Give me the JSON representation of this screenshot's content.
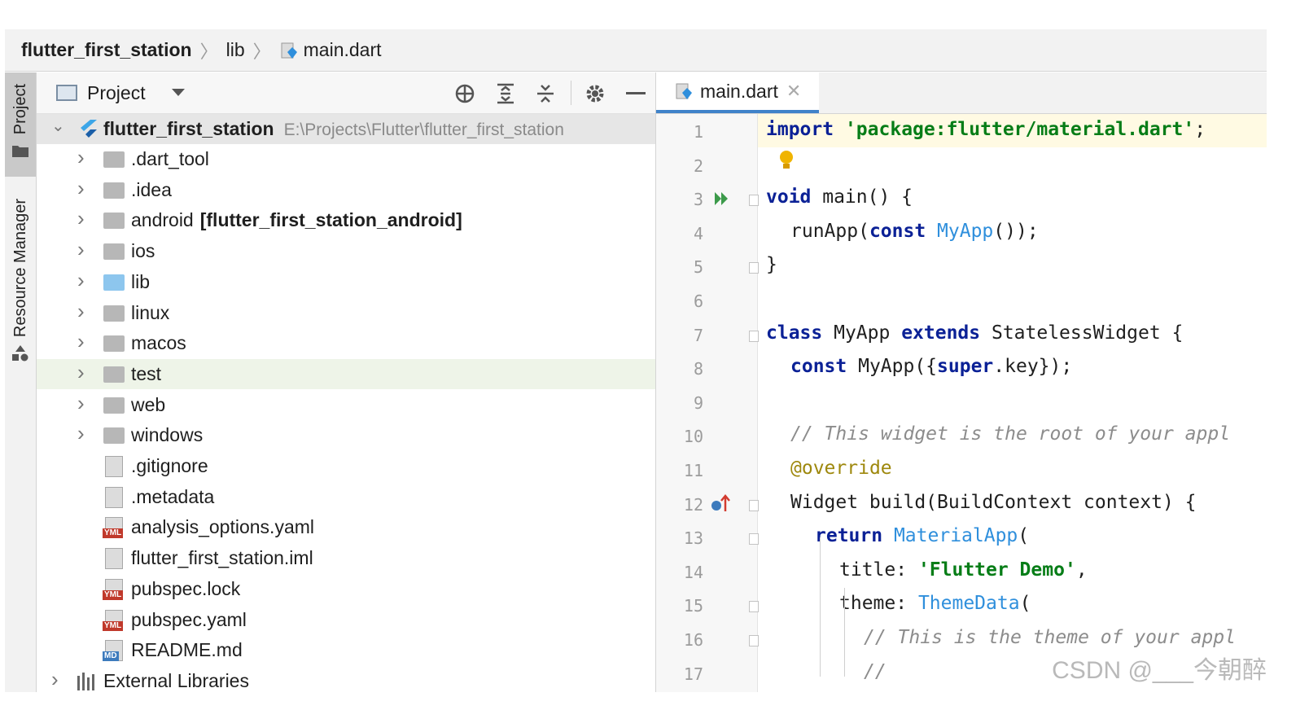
{
  "breadcrumb": {
    "root": "flutter_first_station",
    "folder": "lib",
    "file": "main.dart"
  },
  "toolstrip": {
    "project_label": "Project",
    "resource_label": "Resource Manager"
  },
  "project_panel": {
    "title": "Project",
    "root_name": "flutter_first_station",
    "root_path": "E:\\Projects\\Flutter\\flutter_first_station",
    "items": [
      {
        "label": "dart_tool_prefix",
        "text": ".dart_tool"
      },
      {
        "text": ".idea"
      },
      {
        "text": "android",
        "suffix": "[flutter_first_station_android]"
      },
      {
        "text": "ios"
      },
      {
        "text": "lib"
      },
      {
        "text": "linux"
      },
      {
        "text": "macos"
      },
      {
        "text": "test"
      },
      {
        "text": "web"
      },
      {
        "text": "windows"
      },
      {
        "text": ".gitignore"
      },
      {
        "text": ".metadata"
      },
      {
        "text": "analysis_options.yaml"
      },
      {
        "text": "flutter_first_station.iml"
      },
      {
        "text": "pubspec.lock"
      },
      {
        "text": "pubspec.yaml"
      },
      {
        "text": "README.md"
      }
    ],
    "external_libraries": "External Libraries"
  },
  "editor": {
    "tab_label": "main.dart",
    "lines": [
      {
        "n": "1"
      },
      {
        "n": "2"
      },
      {
        "n": "3"
      },
      {
        "n": "4"
      },
      {
        "n": "5"
      },
      {
        "n": "6"
      },
      {
        "n": "7"
      },
      {
        "n": "8"
      },
      {
        "n": "9"
      },
      {
        "n": "10"
      },
      {
        "n": "11"
      },
      {
        "n": "12"
      },
      {
        "n": "13"
      },
      {
        "n": "14"
      },
      {
        "n": "15"
      },
      {
        "n": "16"
      },
      {
        "n": "17"
      }
    ],
    "code": {
      "l1_kw": "import",
      "l1_str": "'package:flutter/material.dart'",
      "l1_end": ";",
      "l3_kw": "void",
      "l3_rest": " main() {",
      "l4_a": "runApp(",
      "l4_kw": "const",
      "l4_cls": "MyApp",
      "l4_end": "());",
      "l5": "}",
      "l7_kw": "class",
      "l7_a": " MyApp ",
      "l7_kw2": "extends",
      "l7_b": " StatelessWidget {",
      "l8_kw": "const",
      "l8_a": " MyApp({",
      "l8_kw2": "super",
      "l8_b": ".key});",
      "l10": "// This widget is the root of your appl",
      "l11_ann": "@",
      "l11_rest": "override",
      "l12": "Widget build(BuildContext context) {",
      "l13_kw": "return",
      "l13_cls": "MaterialApp",
      "l13_end": "(",
      "l14_a": "title: ",
      "l14_str": "'Flutter Demo'",
      "l14_end": ",",
      "l15_a": "theme: ",
      "l15_cls": "ThemeData",
      "l15_end": "(",
      "l16": "// This is the theme of your appl",
      "l17": "//"
    }
  },
  "watermark": "CSDN @___今朝醉",
  "colors": {
    "keyword": "#0b2196",
    "string": "#067d17",
    "class_ref": "#2f8fdc",
    "comment": "#8c8c8c",
    "tab_underline": "#4083c9",
    "current_line": "#fffae3"
  }
}
